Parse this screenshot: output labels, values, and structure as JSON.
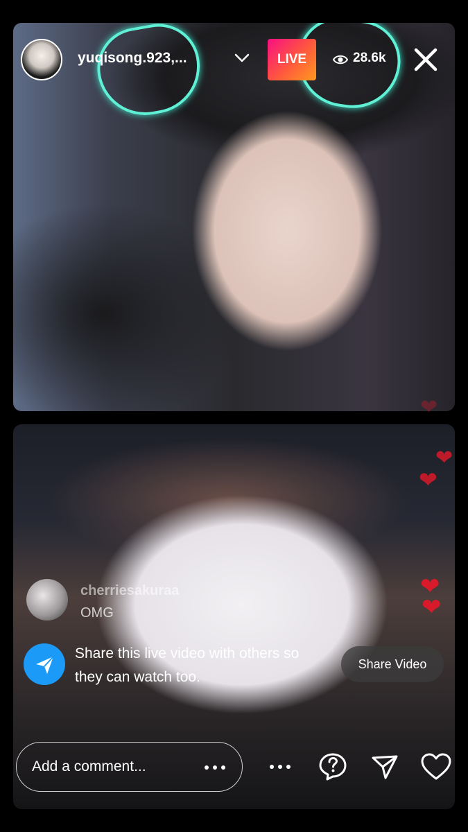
{
  "header": {
    "username": "yuqisong.923,...",
    "live_label": "LIVE",
    "viewer_count": "28.6k"
  },
  "comments": [
    {
      "user": "cherriesakuraa",
      "text": "OMG"
    }
  ],
  "share_prompt": {
    "text": "Share this live video with others so they can watch too.",
    "button_label": "Share Video"
  },
  "composer": {
    "placeholder": "Add a comment..."
  },
  "colors": {
    "live_gradient": [
      "#f70f82",
      "#ff9a1f"
    ],
    "share_blue": "#1b9af7",
    "heart_red": "#d91a2a"
  },
  "icons": [
    "chevron-down-icon",
    "eye-icon",
    "close-icon",
    "send-icon",
    "more-icon",
    "question-icon",
    "heart-icon"
  ]
}
